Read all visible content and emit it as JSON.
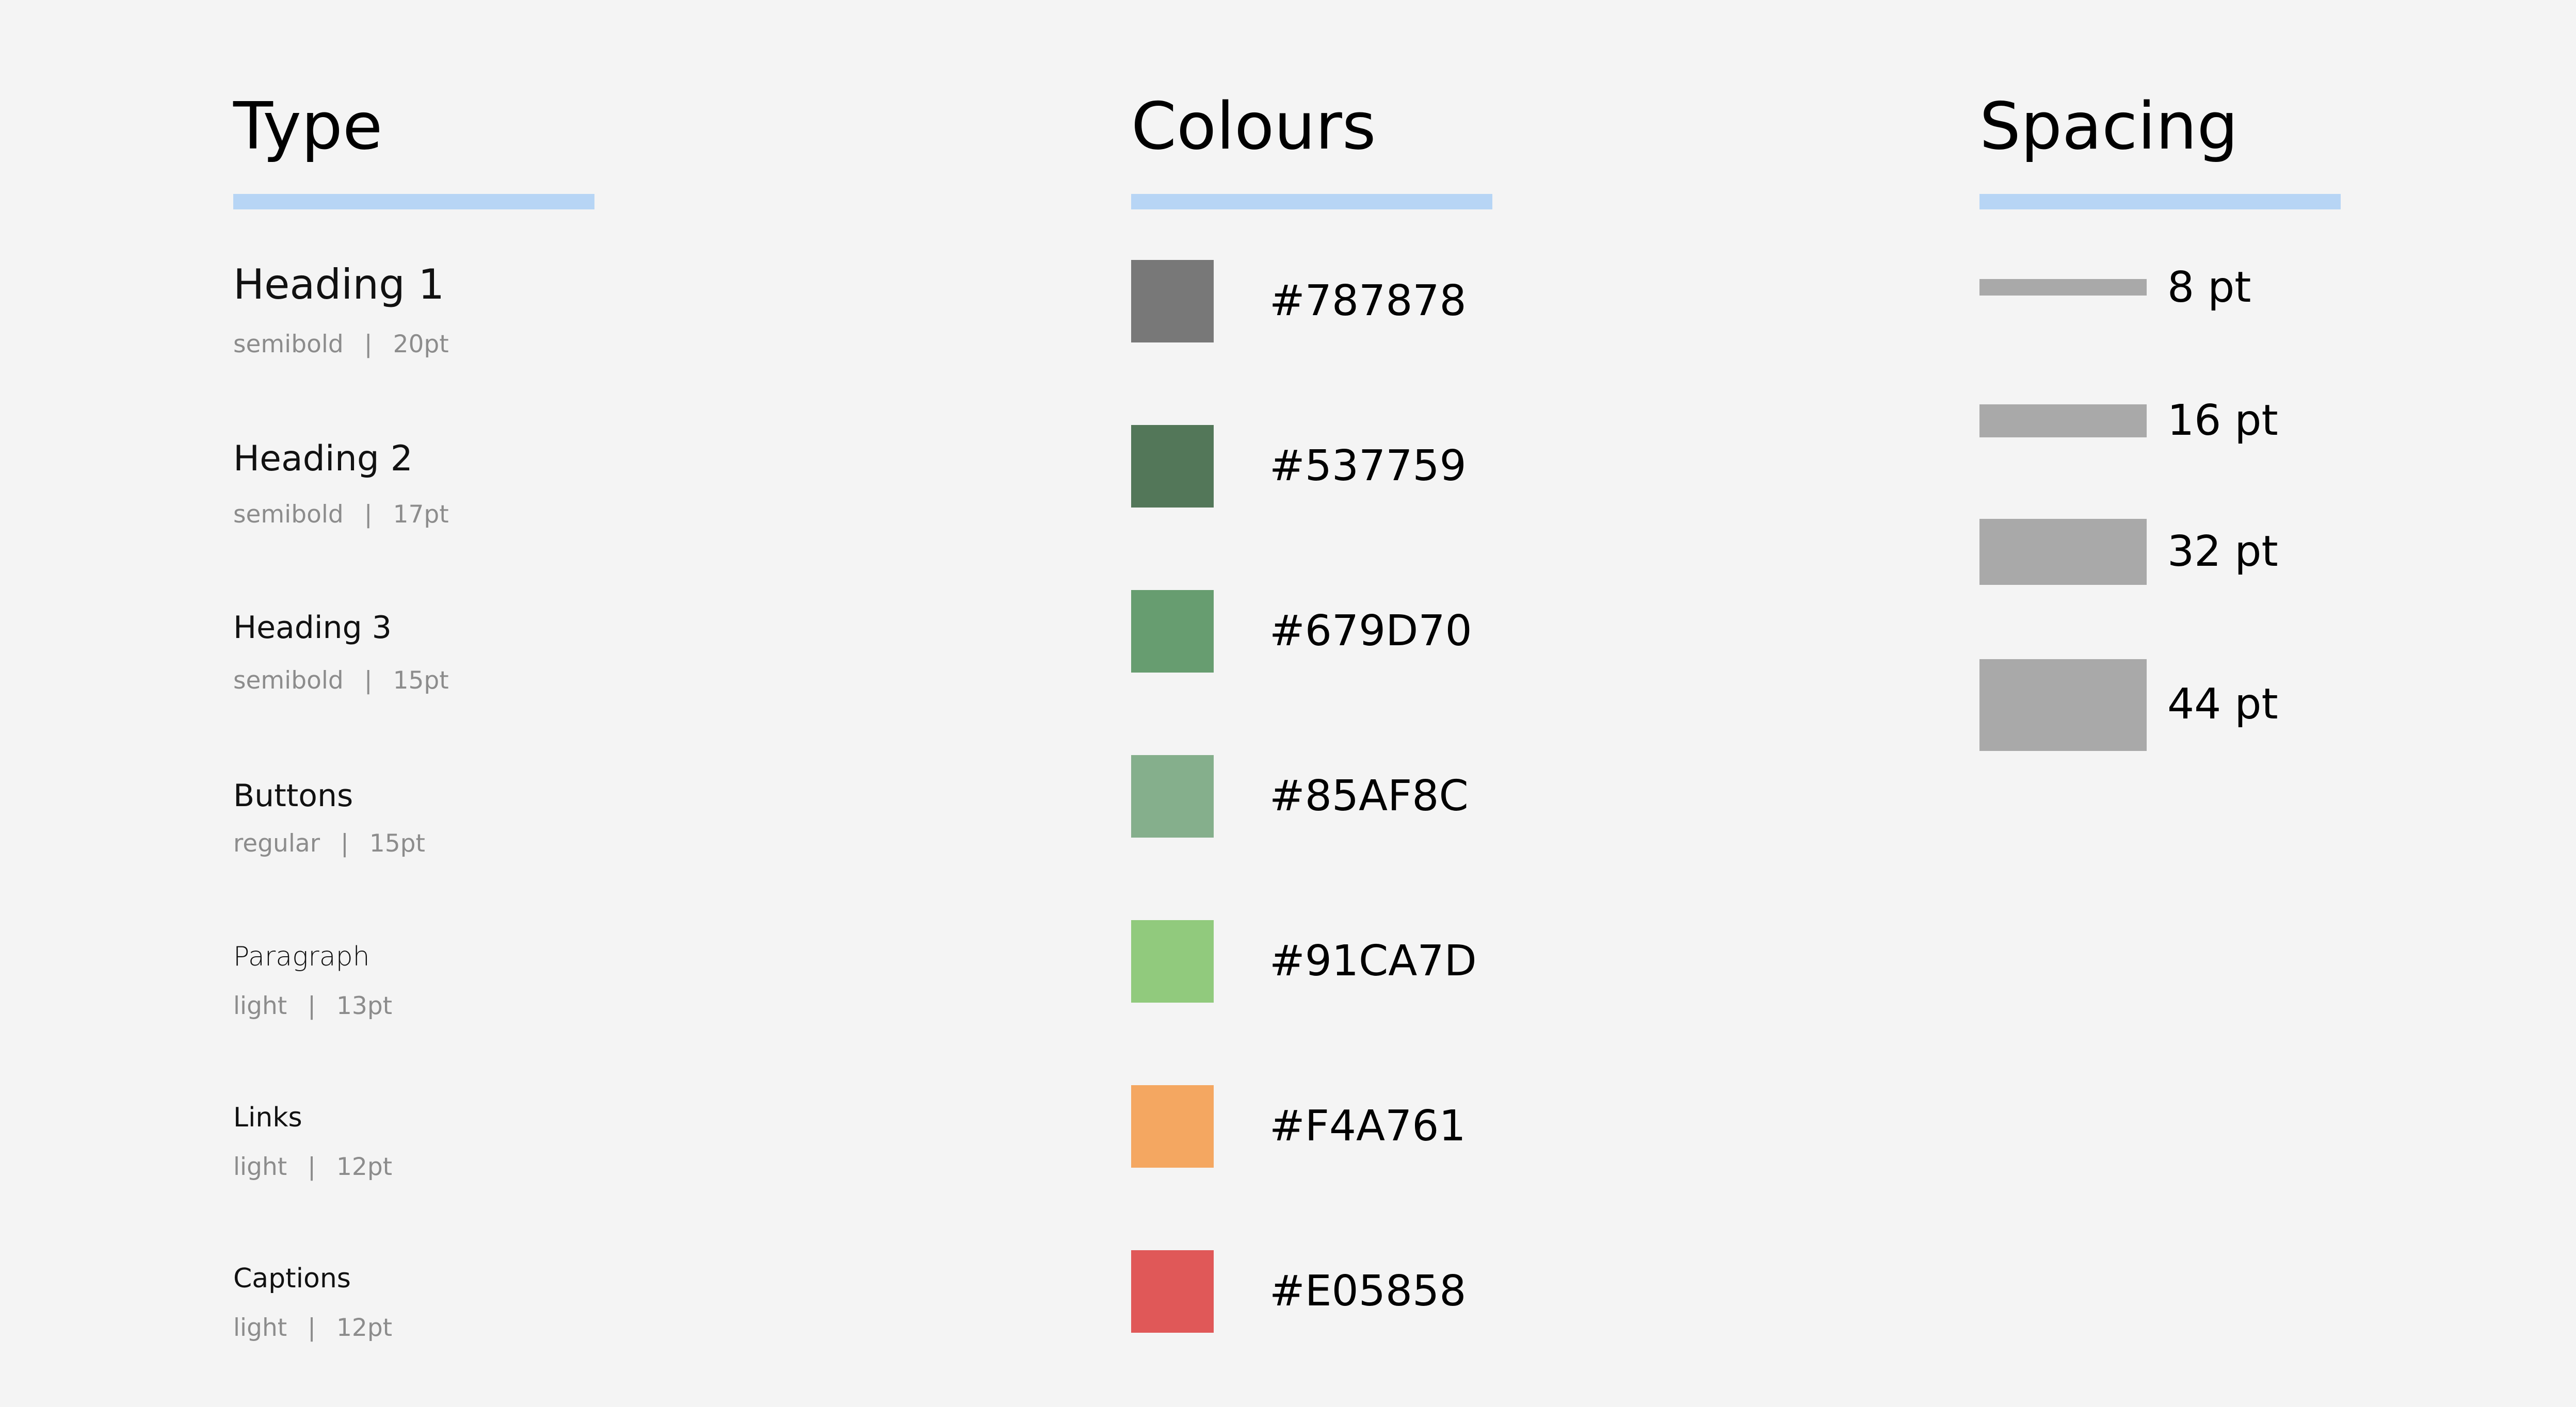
{
  "type": {
    "title": "Type",
    "items": [
      {
        "name": "Heading 1",
        "weight": "semibold",
        "separator": "|",
        "size": "20pt"
      },
      {
        "name": "Heading 2",
        "weight": "semibold",
        "separator": "|",
        "size": "17pt"
      },
      {
        "name": "Heading 3",
        "weight": "semibold",
        "separator": "|",
        "size": "15pt"
      },
      {
        "name": "Buttons",
        "weight": "regular",
        "separator": "|",
        "size": "15pt"
      },
      {
        "name": "Paragraph",
        "weight": "light",
        "separator": "|",
        "size": "13pt"
      },
      {
        "name": "Links",
        "weight": "light",
        "separator": "|",
        "size": "12pt"
      },
      {
        "name": "Captions",
        "weight": "light",
        "separator": "|",
        "size": "12pt"
      }
    ]
  },
  "colours": {
    "title": "Colours",
    "swatches": [
      {
        "label": "#787878",
        "color": "#787878"
      },
      {
        "label": "#537759",
        "color": "#537759"
      },
      {
        "label": "#679D70",
        "color": "#679D70"
      },
      {
        "label": "#85AF8C",
        "color": "#85AF8C"
      },
      {
        "label": "#91CA7D",
        "color": "#91CA7D"
      },
      {
        "label": "#F4A761",
        "color": "#F4A761"
      },
      {
        "label": "#E05858",
        "color": "#E05858"
      }
    ]
  },
  "spacing": {
    "title": "Spacing",
    "items": [
      {
        "label": "8 pt"
      },
      {
        "label": "16 pt"
      },
      {
        "label": "32 pt"
      },
      {
        "label": "44 pt"
      }
    ]
  },
  "theme": {
    "background": "#f4f4f4",
    "underline_color": "#b7d5f5",
    "spacing_bar_color": "#a9a9a9",
    "meta_text_color": "#8c8c8c"
  }
}
